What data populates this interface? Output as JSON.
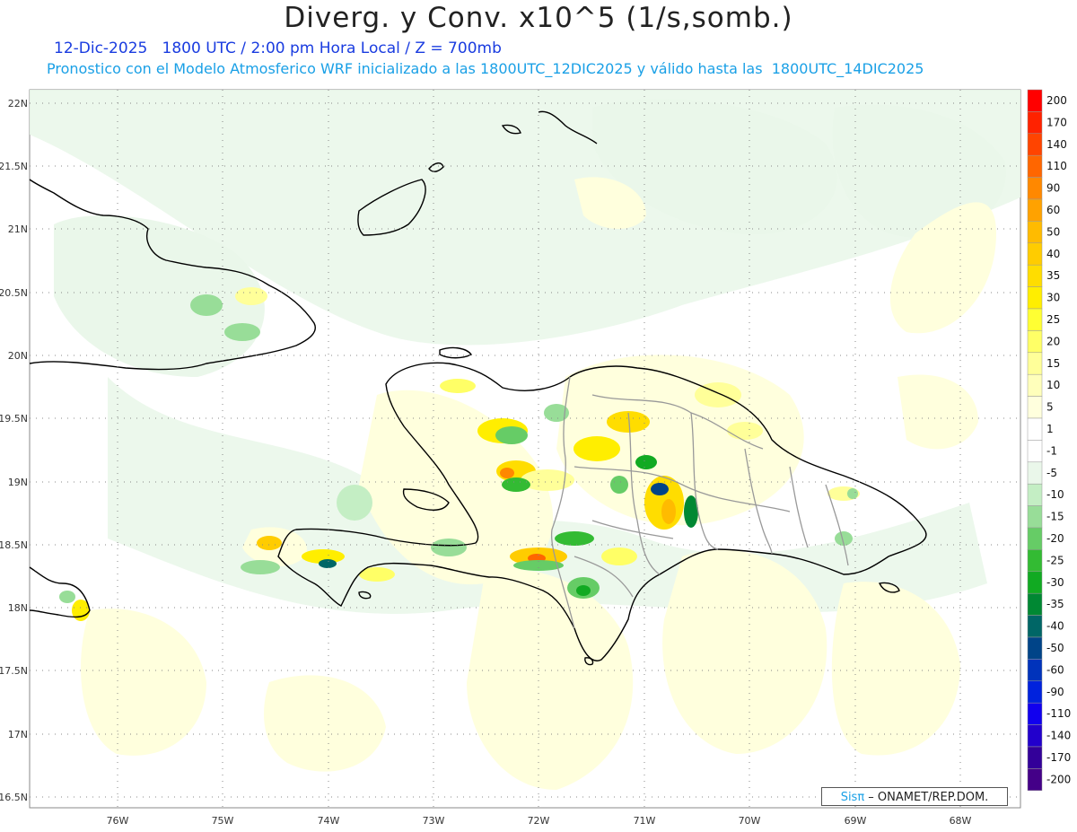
{
  "header": {
    "title": "Diverg. y Conv. x10^5 (1/s,somb.)",
    "line1": "12-Dic-2025   1800 UTC / 2:00 pm Hora Local / Z = 700mb",
    "line2": "Pronostico con el Modelo Atmosferico WRF inicializado a las 1800UTC_12DIC2025 y válido hasta las  1800UTC_14DIC2025"
  },
  "axes": {
    "lat_labels": [
      "22N",
      "21.5N",
      "21N",
      "20.5N",
      "20N",
      "19.5N",
      "19N",
      "18.5N",
      "18N",
      "17.5N",
      "17N",
      "16.5N"
    ],
    "lon_labels": [
      "76W",
      "75W",
      "74W",
      "73W",
      "72W",
      "71W",
      "70W",
      "69W",
      "68W"
    ]
  },
  "colorbar": {
    "levels": [
      "200",
      "170",
      "140",
      "110",
      "90",
      "60",
      "50",
      "40",
      "35",
      "30",
      "25",
      "20",
      "15",
      "10",
      "5",
      "1",
      "-1",
      "-5",
      "-10",
      "-15",
      "-20",
      "-25",
      "-30",
      "-35",
      "-40",
      "-50",
      "-60",
      "-90",
      "-110",
      "-140",
      "-170",
      "-200"
    ],
    "colors": [
      "#ff0000",
      "#ff2200",
      "#ff4400",
      "#ff6600",
      "#ff8800",
      "#ffa200",
      "#ffbb00",
      "#ffcc00",
      "#ffdd00",
      "#ffee00",
      "#ffff33",
      "#ffff66",
      "#ffff99",
      "#ffffbb",
      "#ffffdd",
      "#ffffff",
      "#ffffff",
      "#eaf7ea",
      "#c4eec4",
      "#98dd98",
      "#66cc66",
      "#33bb33",
      "#11aa22",
      "#008833",
      "#006666",
      "#004488",
      "#0033bb",
      "#0022dd",
      "#1100ee",
      "#2200cc",
      "#330099",
      "#440088"
    ]
  },
  "credit": {
    "brand": "Sisπ",
    "text": " – ONAMET/REP.DOM."
  }
}
